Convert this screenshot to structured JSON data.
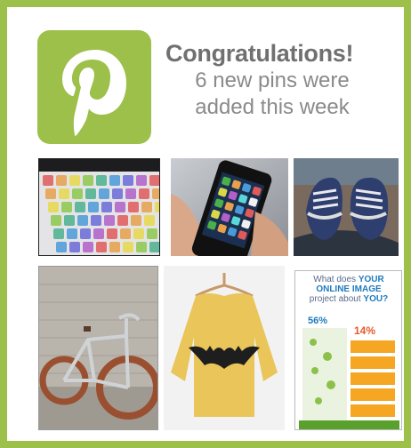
{
  "header": {
    "title": "Congratulations!",
    "subtitle_line1": "6 new pins were",
    "subtitle_line2": "added this week"
  },
  "logo": {
    "icon": "pinterest-logo",
    "bg_color": "#9cc04a"
  },
  "theme": {
    "accent": "#9cc04a",
    "text": "#707070"
  },
  "pins": [
    {
      "subject": "rainbow-keyboard"
    },
    {
      "subject": "smartphone-in-hand"
    },
    {
      "subject": "sneakers-on-feet"
    },
    {
      "subject": "vintage-bicycle"
    },
    {
      "subject": "batman-sweater"
    },
    {
      "subject": "infographic",
      "infographic": {
        "title_line1": "What does",
        "title_word1": "YOUR",
        "title_line2": "ONLINE IMAGE",
        "title_line3": "project about",
        "title_word2": "YOU?",
        "stat_big": "56%",
        "stat_right": "14%"
      }
    }
  ]
}
